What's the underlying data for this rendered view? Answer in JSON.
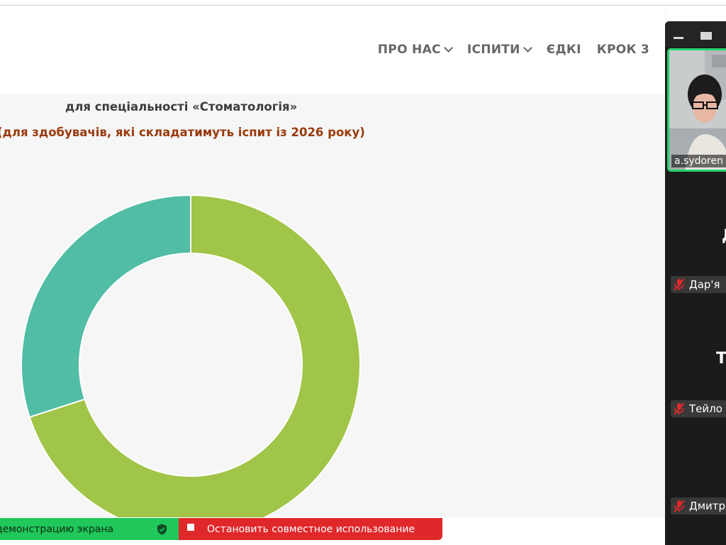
{
  "nav": {
    "items": [
      {
        "label": "ПРО НАС",
        "has_dropdown": true
      },
      {
        "label": "ІСПИТИ",
        "has_dropdown": true
      },
      {
        "label": "ЄДКІ",
        "has_dropdown": false
      },
      {
        "label": "КРОК 3",
        "has_dropdown": false
      }
    ]
  },
  "content": {
    "heading_specialty": "для спеціальності «Стоматологія»",
    "heading_applicants": "(для здобувачів, які складатимуть іспит із 2026 року)"
  },
  "chart_data": {
    "type": "pie",
    "donut": true,
    "slices": [
      {
        "share": 0.7,
        "color": "#a0c548"
      },
      {
        "share": 0.3,
        "color": "#52bda5"
      }
    ]
  },
  "share_bar": {
    "demo_label": "демонстрацию экрана",
    "stop_label": "Остановить совместное использование",
    "demo_color": "#20c75a",
    "stop_color": "#e0282a"
  },
  "zoom_panel": {
    "video_name": "a.sydoren",
    "tiles": [
      {
        "initial": "Д",
        "name": "Дар'я"
      },
      {
        "initial": "Те",
        "name": "Тейло"
      },
      {
        "initial": "",
        "name": "Дмитр"
      }
    ],
    "accent_color": "#23d36a"
  }
}
